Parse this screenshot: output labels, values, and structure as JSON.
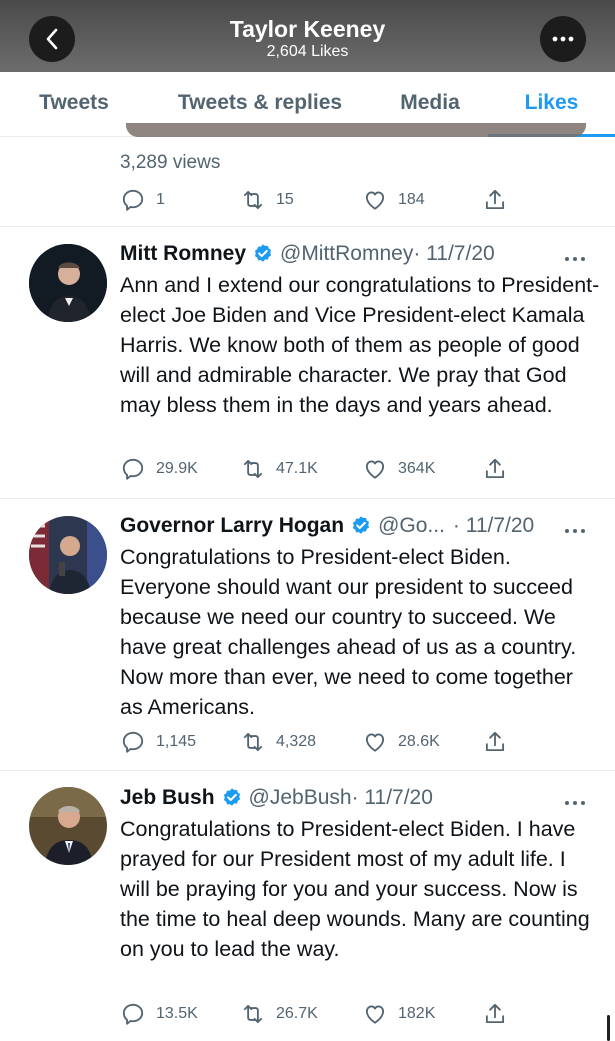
{
  "header": {
    "title": "Taylor Keeney",
    "subtitle": "2,604 Likes",
    "back_icon": "chevron-left-icon",
    "more_icon": "ellipsis-icon"
  },
  "tabs": [
    {
      "label": "Tweets"
    },
    {
      "label": "Tweets & replies"
    },
    {
      "label": "Media"
    },
    {
      "label": "Likes",
      "active": true
    }
  ],
  "previous_tweet": {
    "views": "3,289 views",
    "replies": "1",
    "retweets": "15",
    "likes": "184"
  },
  "tweets": [
    {
      "name": "Mitt Romney",
      "handle": "@MittRomney",
      "date": "· 11/7/20",
      "text": "Ann and I extend our congratulations to President-elect Joe Biden and Vice President-elect Kamala Harris. We know both of them as people of good will and admirable character. We pray that God may bless them in the days and years ahead.",
      "replies": "29.9K",
      "retweets": "47.1K",
      "likes": "364K"
    },
    {
      "name": "Governor Larry Hogan",
      "handle": "@Go...",
      "date": "· 11/7/20",
      "text": "Congratulations to President-elect Biden. Everyone should want our president to succeed because we need our country to succeed. We have great challenges ahead of us as a country. Now more than ever, we need to come together as Americans.",
      "replies": "1,145",
      "retweets": "4,328",
      "likes": "28.6K"
    },
    {
      "name": "Jeb Bush",
      "handle": "@JebBush",
      "date": "· 11/7/20",
      "text": "Congratulations to President-elect Biden. I have prayed for our President most of my adult life. I will be praying for you and your success. Now is the time to heal deep wounds. Many are counting on you to lead the way.",
      "replies": "13.5K",
      "retweets": "26.7K",
      "likes": "182K"
    }
  ],
  "colors": {
    "accent": "#1d9bf0",
    "muted": "#536471",
    "text": "#0f1419"
  }
}
